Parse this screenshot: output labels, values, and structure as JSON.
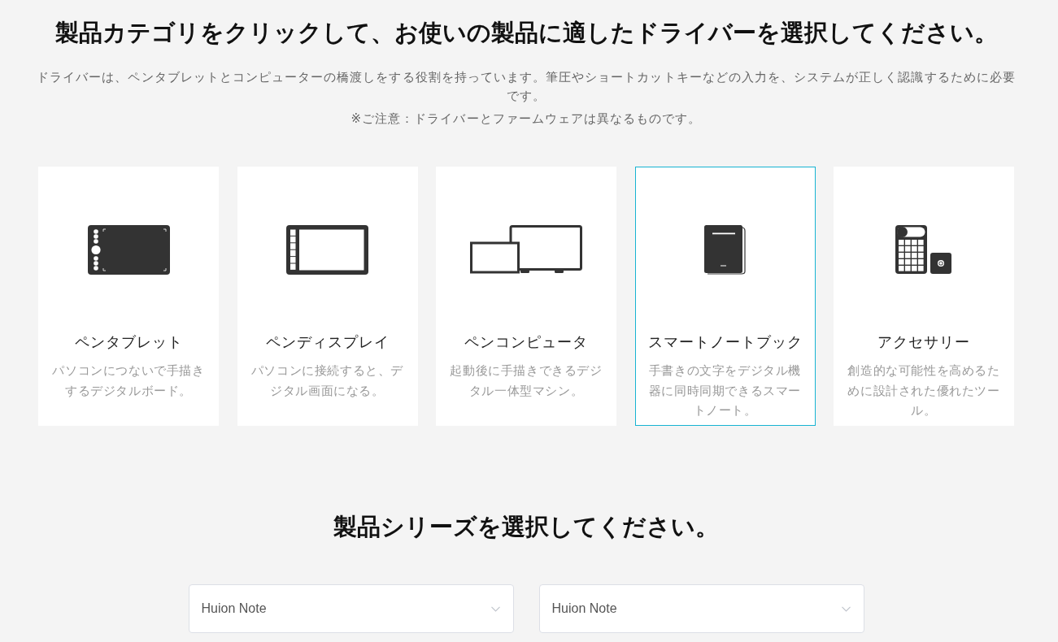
{
  "heading": "製品カテゴリをクリックして、お使いの製品に適したドライバーを選択してください。",
  "intro": "ドライバーは、ペンタブレットとコンピューターの橋渡しをする役割を持っています。筆圧やショートカットキーなどの入力を、システムが正しく認識するために必要です。",
  "note": "※ご注意：ドライバーとファームウェアは異なるものです。",
  "categories": [
    {
      "kind": "tablet",
      "title": "ペンタブレット",
      "description": "パソコンにつないで手描きするデジタルボード。",
      "selected": false
    },
    {
      "kind": "display",
      "title": "ペンディスプレイ",
      "description": "パソコンに接続すると、デジタル画面になる。",
      "selected": false
    },
    {
      "kind": "computer",
      "title": "ペンコンピュータ",
      "description": "起動後に手描きできるデジタル一体型マシン。",
      "selected": false
    },
    {
      "kind": "notebook",
      "title": "スマートノートブック",
      "description": "手書きの文字をデジタル機器に同時同期できるスマートノート。",
      "selected": true
    },
    {
      "kind": "accessory",
      "title": "アクセサリー",
      "description": "創造的な可能性を高めるために設計された優れたツール。",
      "selected": false
    }
  ],
  "series_heading": "製品シリーズを選択してください。",
  "series_selects": [
    {
      "value": "Huion Note"
    },
    {
      "value": "Huion Note"
    }
  ]
}
